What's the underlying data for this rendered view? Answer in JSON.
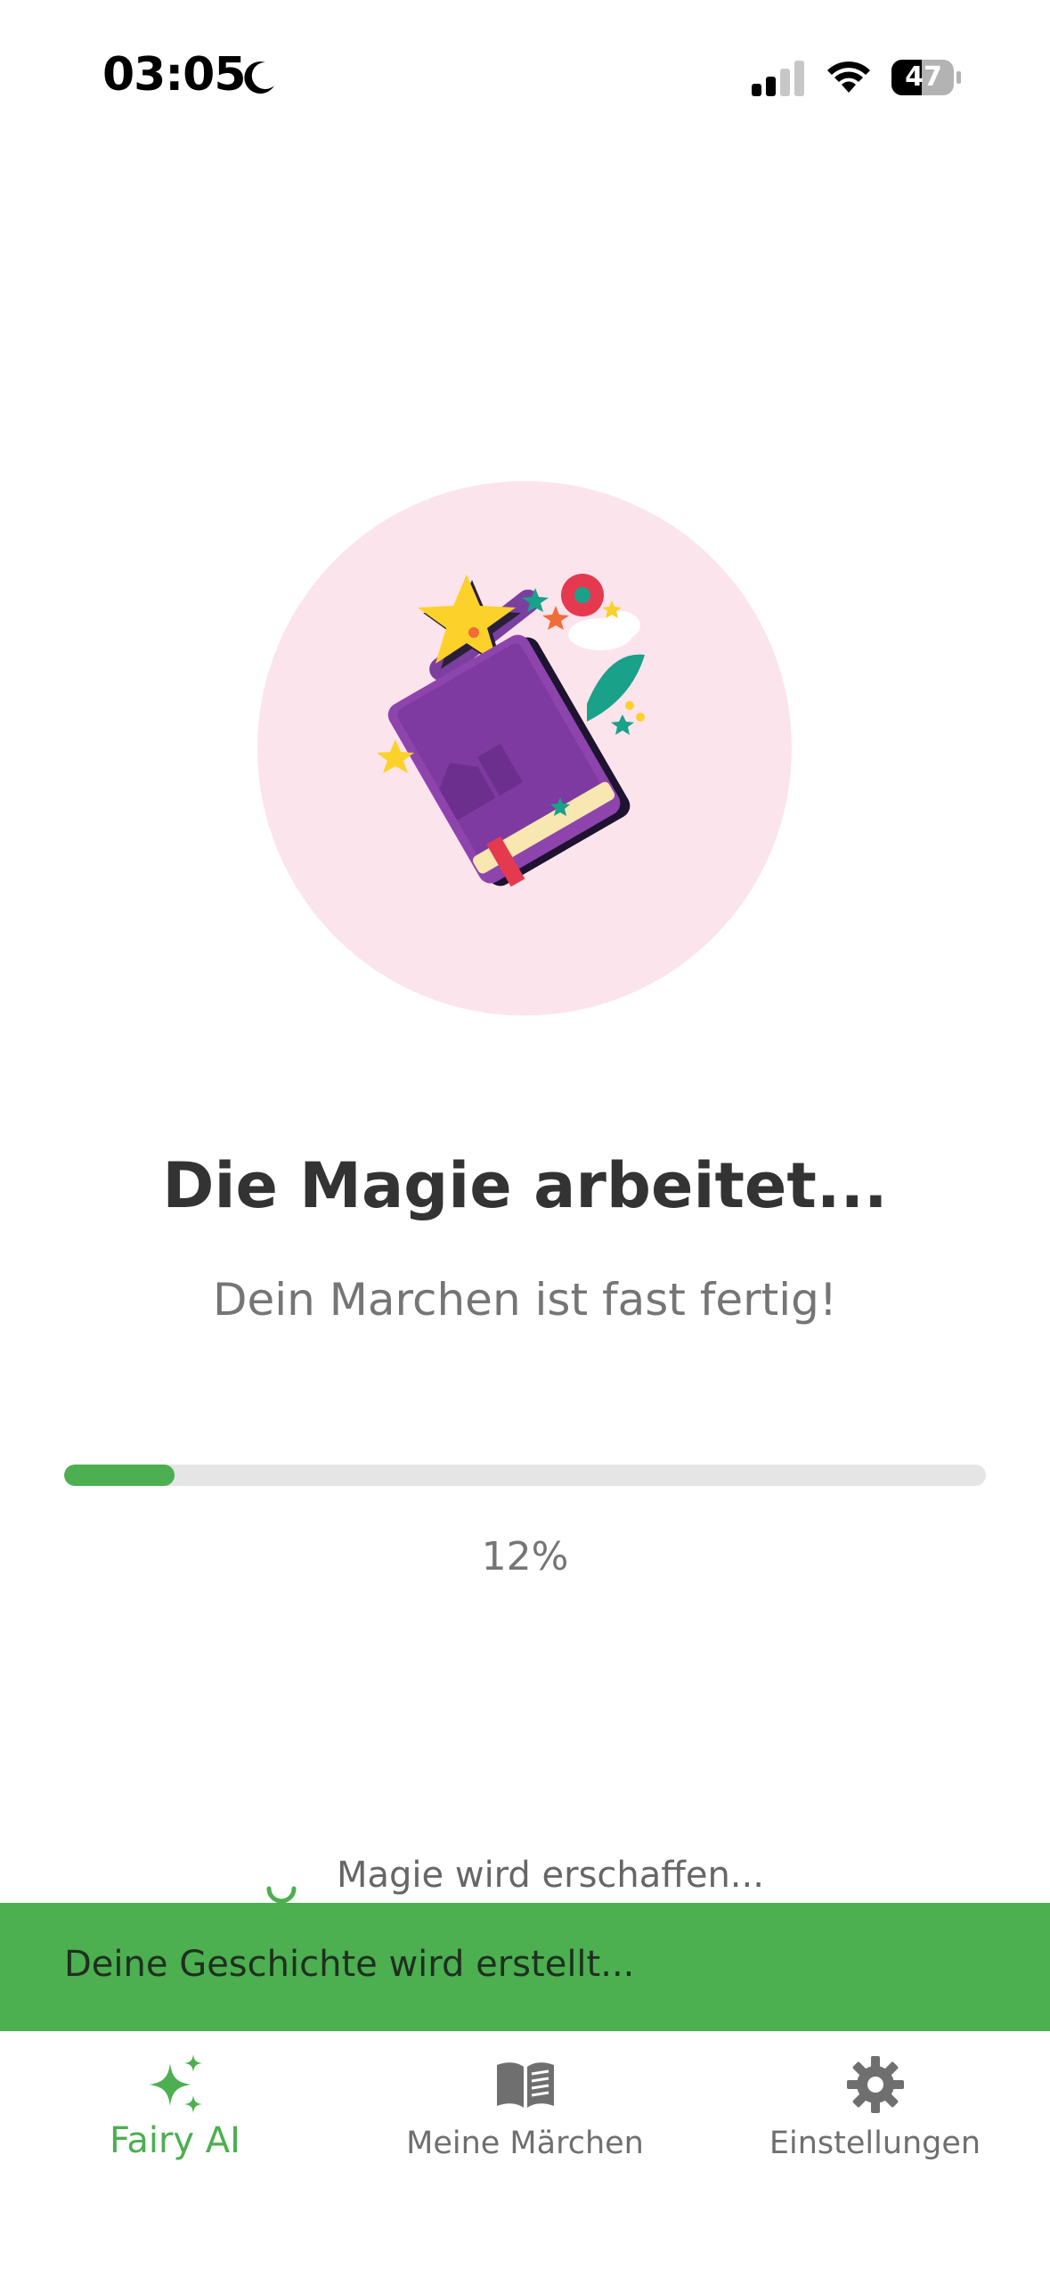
{
  "status_bar": {
    "time": "03:05",
    "battery": "47",
    "icons": [
      "moon-icon",
      "signal-icon",
      "wifi-icon",
      "battery-icon"
    ]
  },
  "illustration": {
    "icon": "magic-book-wand-illustration",
    "background_color": "#fbe4ec"
  },
  "main": {
    "title": "Die Magie arbeitet...",
    "subtitle": "Dein Marchen ist fast fertig!",
    "progress": {
      "value": 0.12,
      "label": "12%",
      "color": "#4caf50"
    },
    "status_text": "Magie wird erschaffen..."
  },
  "snackbar": {
    "text": "Deine Geschichte wird erstellt...",
    "color": "#4caf50"
  },
  "bottom_nav": {
    "items": [
      {
        "label": "Fairy AI",
        "icon": "sparkles-icon",
        "active": true
      },
      {
        "label": "Meine Märchen",
        "icon": "book-icon",
        "active": false
      },
      {
        "label": "Einstellungen",
        "icon": "gear-icon",
        "active": false
      }
    ],
    "active_color": "#4caf50"
  }
}
